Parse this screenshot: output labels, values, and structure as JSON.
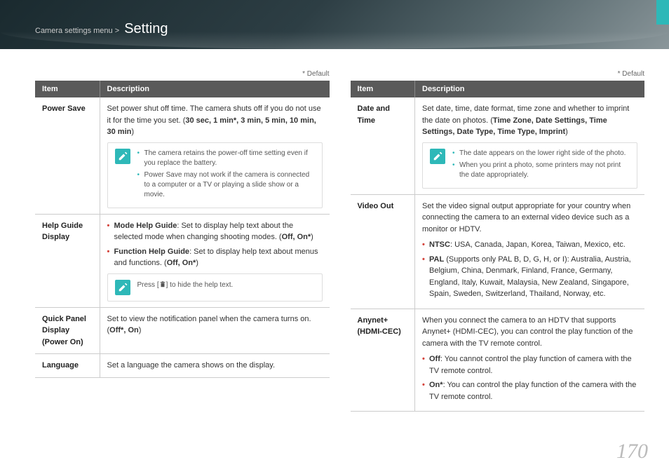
{
  "breadcrumb_prefix": "Camera settings menu >",
  "title": "Setting",
  "default_label": "* Default",
  "headers": {
    "item": "Item",
    "desc": "Description"
  },
  "page_number": "170",
  "left": {
    "power_save": {
      "item": "Power Save",
      "desc_1": "Set power shut off time. The camera shuts off if you do not use it for the time you set. (",
      "opts": "30 sec, 1 min*, 3 min, 5 min, 10 min, 30 min",
      "desc_2": ")",
      "tip1": "The camera retains the power-off time setting even if you replace the battery.",
      "tip2": "Power Save may not work if the camera is connected to a computer or a TV or playing a slide show or a movie."
    },
    "help": {
      "item": "Help Guide Display",
      "mode_b": "Mode Help Guide",
      "mode_t": ": Set to display help text about the selected mode when changing shooting modes. (",
      "mode_o": "Off, On*",
      "func_b": "Function Help Guide",
      "func_t": ": Set to display help text about menus and functions. (",
      "func_o": "Off, On*",
      "tip_a": "Press [",
      "tip_b": "] to hide the help text."
    },
    "quick": {
      "item": "Quick Panel Display (Power On)",
      "txt": "Set to view the notification panel when the camera turns on. (",
      "opts": "Off*, On",
      "close": ")"
    },
    "lang": {
      "item": "Language",
      "txt": "Set a language the camera shows on the display."
    }
  },
  "right": {
    "date": {
      "item": "Date and Time",
      "txt": "Set date, time, date format, time zone and whether to imprint the date on photos. (",
      "opts": "Time Zone, Date Settings, Time Settings, Date Type, Time Type, Imprint",
      "close": ")",
      "tip1": "The date appears on the lower right side of the photo.",
      "tip2": "When you print a photo, some printers may not print the date appropriately."
    },
    "video": {
      "item": "Video Out",
      "intro": "Set the video signal output appropriate for your country when connecting the camera to an external video device such as a monitor or HDTV.",
      "ntsc_b": "NTSC",
      "ntsc_t": ": USA, Canada, Japan, Korea, Taiwan, Mexico, etc.",
      "pal_b": "PAL",
      "pal_t": " (Supports only PAL B, D, G, H, or I): Australia, Austria, Belgium, China, Denmark, Finland, France, Germany, England, Italy, Kuwait, Malaysia, New Zealand, Singapore, Spain, Sweden, Switzerland, Thailand, Norway, etc."
    },
    "anynet": {
      "item": "Anynet+ (HDMI-CEC)",
      "intro": "When you connect the camera to an HDTV that supports Anynet+ (HDMI-CEC), you can control the play function of the camera with the TV remote control.",
      "off_b": "Off",
      "off_t": ": You cannot control the play function of camera with the TV remote control.",
      "on_b": "On*",
      "on_t": ": You can control the play function of the camera with the TV remote control."
    }
  }
}
